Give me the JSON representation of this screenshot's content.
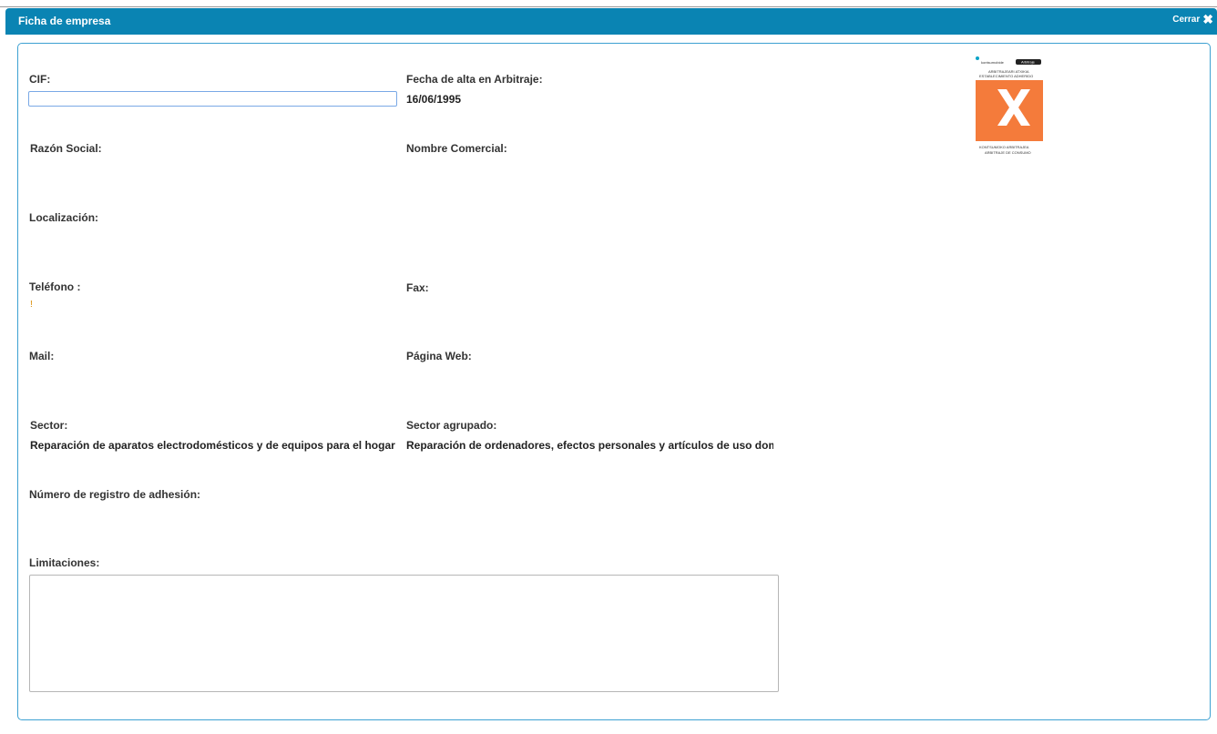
{
  "window": {
    "title": "Ficha de empresa",
    "close_label": "Cerrar"
  },
  "form": {
    "cif": {
      "label": "CIF:",
      "value": ""
    },
    "fecha_alta": {
      "label": "Fecha de alta en Arbitraje:",
      "value": "16/06/1995"
    },
    "razon_social": {
      "label": "Razón Social:",
      "value": ""
    },
    "nombre_comercial": {
      "label": "Nombre Comercial:",
      "value": ""
    },
    "localizacion": {
      "label": "Localización:",
      "value": ""
    },
    "telefono": {
      "label": "Teléfono :",
      "value": "!"
    },
    "fax": {
      "label": "Fax:",
      "value": ""
    },
    "mail": {
      "label": "Mail:",
      "value": ""
    },
    "pagina_web": {
      "label": "Página Web:",
      "value": ""
    },
    "sector": {
      "label": "Sector:",
      "value": "Reparación de aparatos electrodomésticos y de equipos para el hogar y el jardín"
    },
    "sector_agrupado": {
      "label": "Sector agrupado:",
      "value": "Reparación de ordenadores, efectos personales y artículos de uso doméstico"
    },
    "numero_registro": {
      "label": "Número de registro de adhesión:",
      "value": ""
    },
    "limitaciones": {
      "label": "Limitaciones:",
      "value": ""
    }
  },
  "logo": {
    "top_left_text": "kontsumobide",
    "top_right_text": "Arbitraje",
    "line1": "ARBITRAJEARI ATXIKIA",
    "line2": "ESTABLECIMIENTO ADHERIDO",
    "line3": "KONTSUMOKO ARBITRAJEA",
    "line4": "ARBITRAJE DE CONSUMO",
    "accent_color": "#f47b3b"
  },
  "colors": {
    "titlebar": "#0a84b3",
    "panel_border": "#3da1d2"
  },
  "icons": {
    "close": "close-x-icon"
  }
}
